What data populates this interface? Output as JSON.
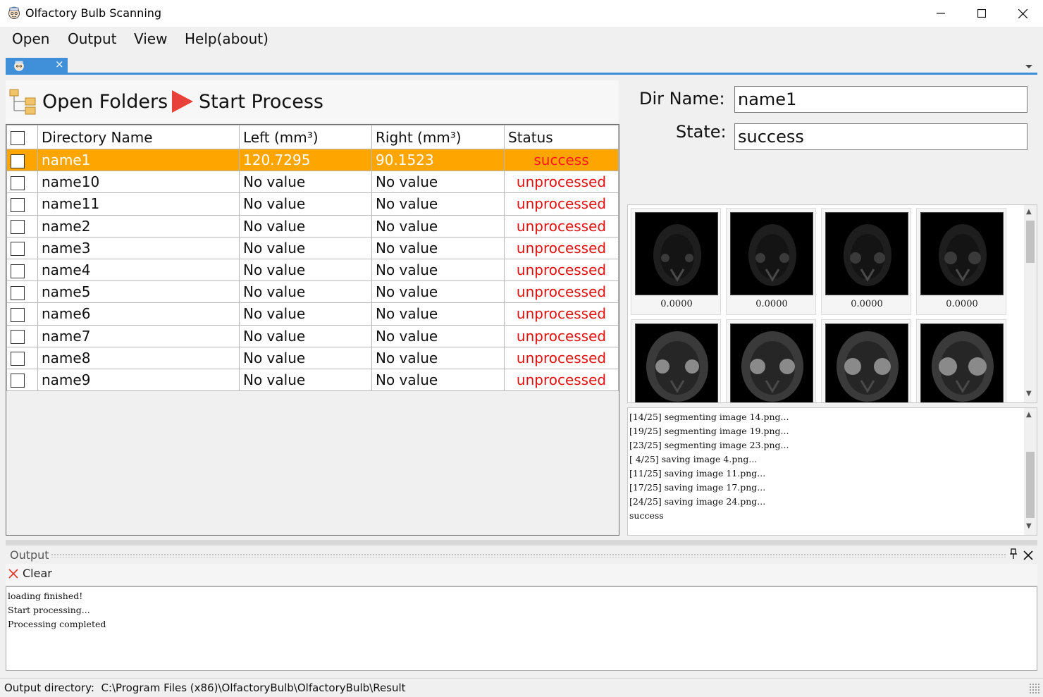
{
  "window": {
    "title": "Olfactory Bulb Scanning",
    "icon": "doctor-face-icon"
  },
  "menu": {
    "items": [
      "Open",
      "Output",
      "View",
      "Help(about)"
    ]
  },
  "doc_tab": {
    "icon": "doctor-face-icon",
    "close": "×"
  },
  "toolbar": {
    "open_folders_label": "Open Folders",
    "start_process_label": "Start Process"
  },
  "table": {
    "columns": [
      "Directory Name",
      "Left (mm³)",
      "Right (mm³)",
      "Status"
    ],
    "rows": [
      {
        "name": "name1",
        "left": "120.7295",
        "right": "90.1523",
        "status": "success",
        "selected": true
      },
      {
        "name": "name10",
        "left": "No value",
        "right": "No value",
        "status": "unprocessed"
      },
      {
        "name": "name11",
        "left": "No value",
        "right": "No value",
        "status": "unprocessed"
      },
      {
        "name": "name2",
        "left": "No value",
        "right": "No value",
        "status": "unprocessed"
      },
      {
        "name": "name3",
        "left": "No value",
        "right": "No value",
        "status": "unprocessed"
      },
      {
        "name": "name4",
        "left": "No value",
        "right": "No value",
        "status": "unprocessed"
      },
      {
        "name": "name5",
        "left": "No value",
        "right": "No value",
        "status": "unprocessed"
      },
      {
        "name": "name6",
        "left": "No value",
        "right": "No value",
        "status": "unprocessed"
      },
      {
        "name": "name7",
        "left": "No value",
        "right": "No value",
        "status": "unprocessed"
      },
      {
        "name": "name8",
        "left": "No value",
        "right": "No value",
        "status": "unprocessed"
      },
      {
        "name": "name9",
        "left": "No value",
        "right": "No value",
        "status": "unprocessed"
      }
    ]
  },
  "details": {
    "dir_name_label": "Dir Name:",
    "dir_name_value": "name1",
    "state_label": "State:",
    "state_value": "success"
  },
  "thumbnails": [
    {
      "value": "0.0000"
    },
    {
      "value": "0.0000"
    },
    {
      "value": "0.0000"
    },
    {
      "value": "0.0000"
    },
    {
      "value": ""
    },
    {
      "value": ""
    },
    {
      "value": ""
    },
    {
      "value": ""
    }
  ],
  "process_log": [
    "[14/25] segmenting image 14.png...",
    "[19/25] segmenting image 19.png...",
    "[23/25] segmenting image 23.png...",
    "[ 4/25] saving image 4.png...",
    "[11/25] saving image 11.png...",
    "[17/25] saving image 17.png...",
    "[24/25] saving image 24.png...",
    "success"
  ],
  "output_pane": {
    "title": "Output",
    "clear_label": "Clear",
    "lines": [
      "loading finished!",
      "Start processing...",
      "Processing completed"
    ]
  },
  "statusbar": {
    "text": "Output directory:  C:\\Program Files (x86)\\OlfactoryBulb\\OlfactoryBulb\\Result"
  },
  "colors": {
    "accent": "#3f90d8",
    "selected_row": "#ffa500",
    "status_red": "#e01010"
  }
}
